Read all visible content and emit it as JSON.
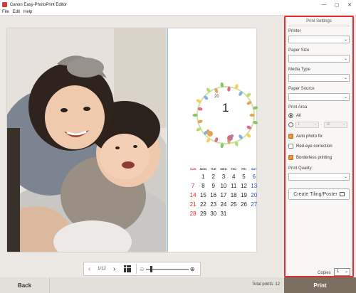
{
  "app": {
    "title": "Canon Easy-PhotoPrint Editor",
    "menu": [
      "File",
      "Edit",
      "Help"
    ],
    "window_controls": [
      "—",
      "▢",
      "✕"
    ]
  },
  "calendar": {
    "year": "20",
    "month": "1",
    "weekdays": [
      "SUN",
      "MON",
      "TUE",
      "WED",
      "THU",
      "FRI",
      "SAT"
    ],
    "weeks": [
      [
        "",
        "1",
        "2",
        "3",
        "4",
        "5",
        "6"
      ],
      [
        "7",
        "8",
        "9",
        "10",
        "11",
        "12",
        "13"
      ],
      [
        "14",
        "15",
        "16",
        "17",
        "18",
        "19",
        "20"
      ],
      [
        "21",
        "22",
        "23",
        "24",
        "25",
        "26",
        "27"
      ],
      [
        "28",
        "29",
        "30",
        "31",
        "",
        "",
        ""
      ]
    ]
  },
  "navigation": {
    "page_indicator": "1/12",
    "prev_icon": "chevron-left-icon",
    "next_icon": "chevron-right-icon",
    "zoom_level": 0.1
  },
  "settings": {
    "title": "Print Settings",
    "printer_label": "Printer",
    "paper_size_label": "Paper Size",
    "media_type_label": "Media Type",
    "paper_source_label": "Paper Source",
    "print_area_label": "Print Area",
    "all_label": "All",
    "range_from": "1",
    "range_to": "12",
    "range_sep": "-",
    "auto_photo_fix_label": "Auto photo fix",
    "auto_photo_fix_checked": true,
    "red_eye_label": "Red-eye correction",
    "red_eye_checked": false,
    "borderless_label": "Borderless printing",
    "borderless_checked": true,
    "print_quality_label": "Print Quality",
    "tiling_button": "Create Tiling/Poster",
    "copies_label": "Copies",
    "copies_value": "1"
  },
  "footer": {
    "back_label": "Back",
    "total_prints": "Total prints: 12",
    "print_label": "Print"
  },
  "colors": {
    "highlight_border": "#e42f2f",
    "print_button": "#7a6f61",
    "checkbox_on": "#e08a2c",
    "sunday": "#d8282a",
    "saturday": "#2450c9"
  }
}
